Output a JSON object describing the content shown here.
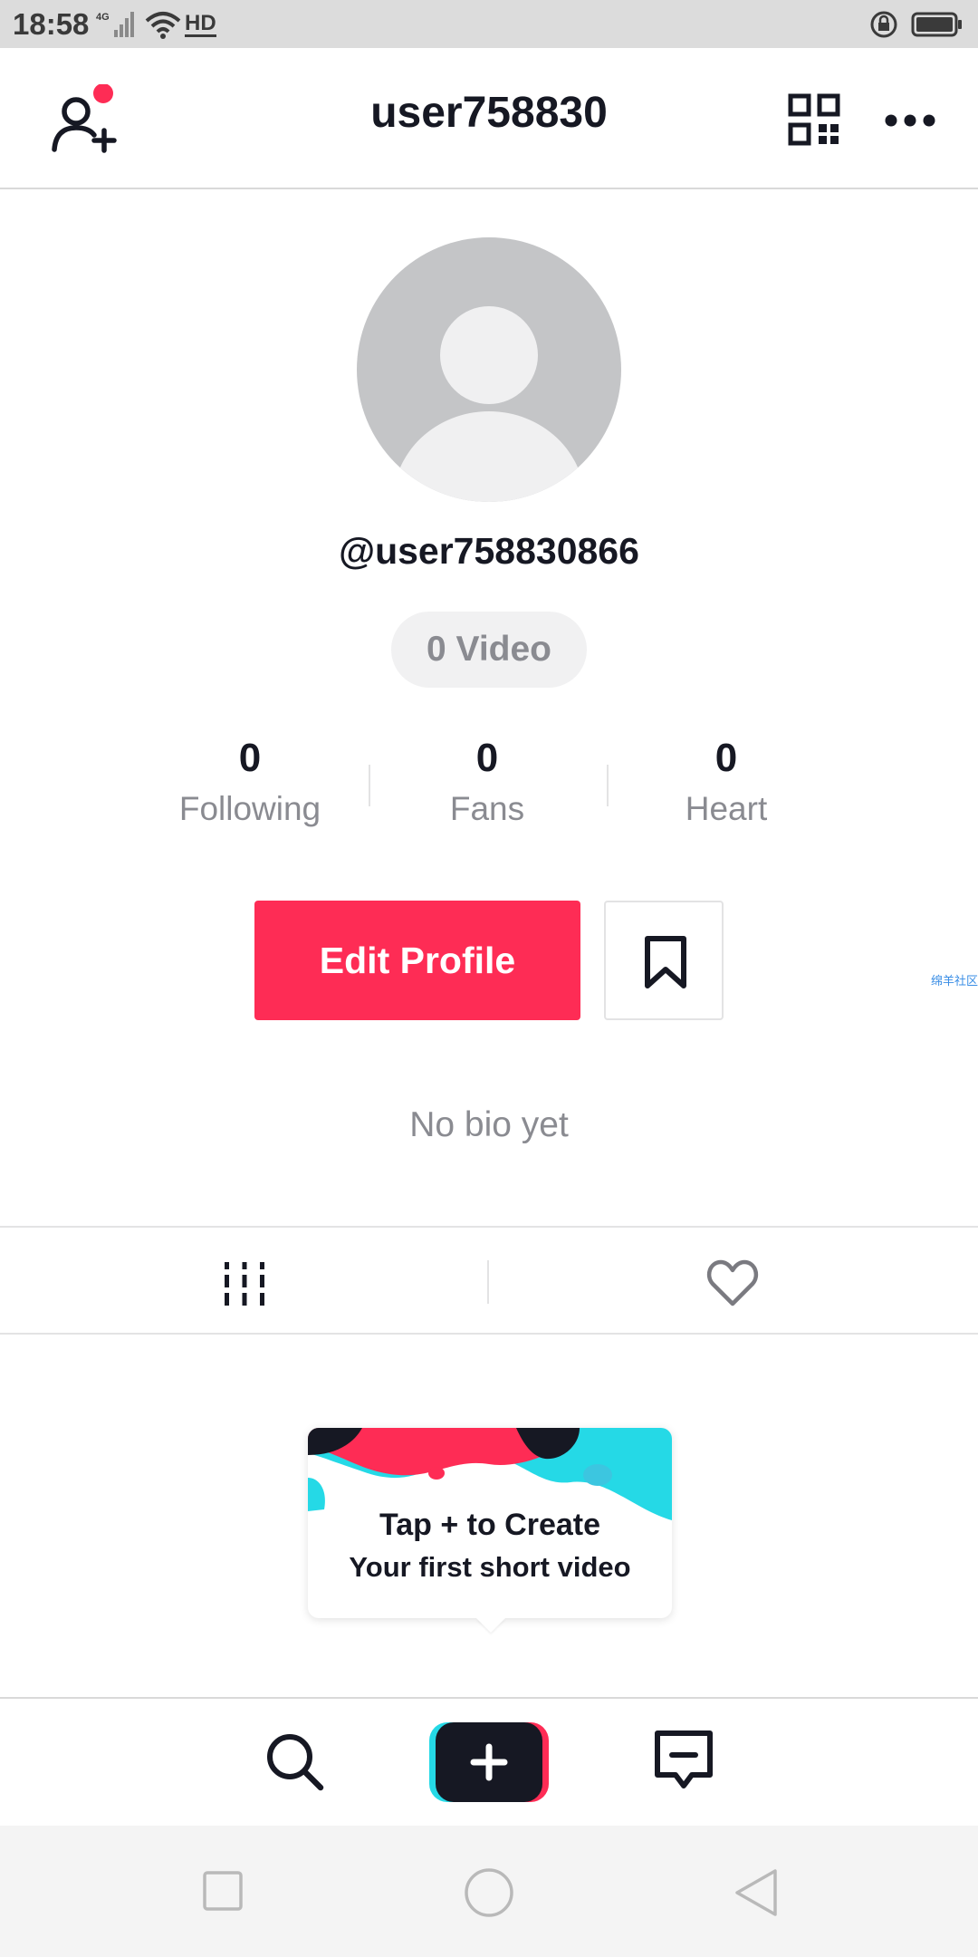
{
  "status_bar": {
    "time": "18:58",
    "network": "4G",
    "hd": "HD",
    "icons": [
      "signal-icon",
      "wifi-icon",
      "hd-icon",
      "rotation-lock-icon",
      "battery-icon"
    ]
  },
  "top_bar": {
    "title": "user758830",
    "icons": [
      "add-user-icon",
      "qr-code-icon",
      "more-icon"
    ],
    "notification_dot_color": "#fe2c55"
  },
  "profile": {
    "handle": "@user758830866",
    "video_count_label": "0 Video",
    "stats": [
      {
        "value": "0",
        "label": "Following"
      },
      {
        "value": "0",
        "label": "Fans"
      },
      {
        "value": "0",
        "label": "Heart"
      }
    ],
    "edit_profile_label": "Edit Profile",
    "side_tag": "绵羊社区",
    "bio": "No bio yet"
  },
  "content_tabs": {
    "icons": [
      "video-grid-icon",
      "heart-icon"
    ],
    "selected": 0
  },
  "create_tip": {
    "line1": "Tap + to Create",
    "line2": "Your first short video"
  },
  "bottom_nav": {
    "icons": [
      "search-icon",
      "plus-icon",
      "inbox-icon"
    ]
  },
  "system_nav": {
    "icons": [
      "recents-icon",
      "home-icon",
      "back-icon"
    ]
  },
  "colors": {
    "accent": "#fe2c55",
    "cyan": "#25d9e6",
    "text_primary": "#161823",
    "text_secondary": "#8a8b91"
  }
}
